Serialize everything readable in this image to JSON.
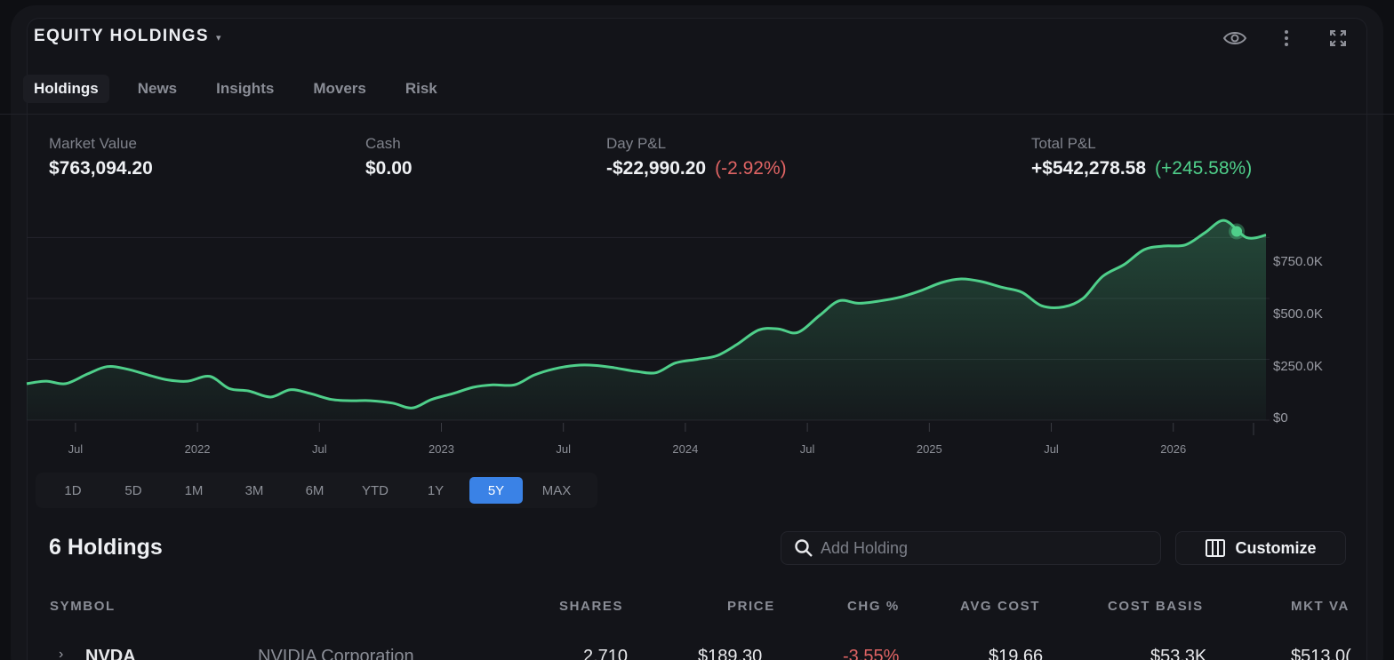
{
  "header": {
    "title": "EQUITY HOLDINGS",
    "caret": "▾",
    "icons": [
      "eye-icon",
      "more-vertical-icon",
      "expand-icon"
    ]
  },
  "tabs": [
    {
      "label": "Holdings",
      "active": true
    },
    {
      "label": "News",
      "active": false
    },
    {
      "label": "Insights",
      "active": false
    },
    {
      "label": "Movers",
      "active": false
    },
    {
      "label": "Risk",
      "active": false
    }
  ],
  "summary": {
    "market_value": {
      "label": "Market Value",
      "value": "$763,094.20"
    },
    "cash": {
      "label": "Cash",
      "value": "$0.00"
    },
    "day_pl": {
      "label": "Day P&L",
      "value": "-$22,990.20",
      "pct": "(-2.92%)"
    },
    "total_pl": {
      "label": "Total P&L",
      "value": "+$542,278.58",
      "pct": "(+245.58%)"
    }
  },
  "colors": {
    "accent": "#3a82e6",
    "line": "#4fcf8a",
    "negative": "#e06464",
    "positive": "#4fcf8a"
  },
  "chart_data": {
    "type": "area",
    "y_ticks": [
      "$750.0K",
      "$500.0K",
      "$250.0K",
      "$0"
    ],
    "x_ticks": [
      "Jul",
      "2022",
      "Jul",
      "2023",
      "Jul",
      "2024",
      "Jul",
      "2025",
      "Jul",
      "2026"
    ],
    "ylim": [
      0,
      850000
    ],
    "grid": true,
    "x": [
      2021.3,
      2021.38,
      2021.46,
      2021.55,
      2021.63,
      2021.71,
      2021.8,
      2021.88,
      2021.96,
      2022.05,
      2022.13,
      2022.21,
      2022.3,
      2022.38,
      2022.46,
      2022.55,
      2022.63,
      2022.71,
      2022.8,
      2022.88,
      2022.96,
      2023.05,
      2023.13,
      2023.21,
      2023.3,
      2023.38,
      2023.46,
      2023.55,
      2023.63,
      2023.71,
      2023.8,
      2023.88,
      2023.96,
      2024.05,
      2024.13,
      2024.21,
      2024.3,
      2024.38,
      2024.46,
      2024.55,
      2024.63,
      2024.71,
      2024.8,
      2024.88,
      2024.96,
      2025.05,
      2025.13,
      2025.21,
      2025.3,
      2025.38,
      2025.46,
      2025.55,
      2025.63,
      2025.71,
      2025.8,
      2025.88,
      2025.96,
      2026.05,
      2026.13,
      2026.21,
      2026.3,
      2026.38
    ],
    "values": [
      150000,
      160000,
      150000,
      190000,
      220000,
      210000,
      185000,
      165000,
      160000,
      180000,
      130000,
      120000,
      95000,
      125000,
      110000,
      85000,
      80000,
      80000,
      70000,
      50000,
      85000,
      110000,
      135000,
      145000,
      145000,
      185000,
      210000,
      225000,
      225000,
      215000,
      200000,
      195000,
      235000,
      250000,
      265000,
      310000,
      370000,
      375000,
      360000,
      430000,
      490000,
      480000,
      490000,
      505000,
      530000,
      565000,
      580000,
      570000,
      545000,
      525000,
      470000,
      465000,
      500000,
      590000,
      640000,
      700000,
      715000,
      720000,
      770000,
      820000,
      750000,
      760000
    ],
    "highlight_value": 775000
  },
  "ranges": [
    {
      "label": "1D",
      "active": false
    },
    {
      "label": "5D",
      "active": false
    },
    {
      "label": "1M",
      "active": false
    },
    {
      "label": "3M",
      "active": false
    },
    {
      "label": "6M",
      "active": false
    },
    {
      "label": "YTD",
      "active": false
    },
    {
      "label": "1Y",
      "active": false
    },
    {
      "label": "5Y",
      "active": true
    },
    {
      "label": "MAX",
      "active": false
    }
  ],
  "holdings": {
    "count_label": "6 Holdings",
    "search_placeholder": "Add Holding",
    "customize_label": "Customize"
  },
  "table": {
    "headers": {
      "symbol": "SYMBOL",
      "shares": "SHARES",
      "price": "PRICE",
      "chg": "CHG %",
      "avg_cost": "AVG COST",
      "cost_basis": "COST BASIS",
      "mkt_value": "MKT VA"
    },
    "rows": [
      {
        "caret": "›",
        "symbol": "NVDA",
        "name": "NVIDIA Corporation",
        "shares": "2,710",
        "price": "$189.30",
        "chg": "-3.55%",
        "avg_cost": "$19.66",
        "cost_basis": "$53.3K",
        "mkt_value": "$513.0("
      }
    ]
  }
}
